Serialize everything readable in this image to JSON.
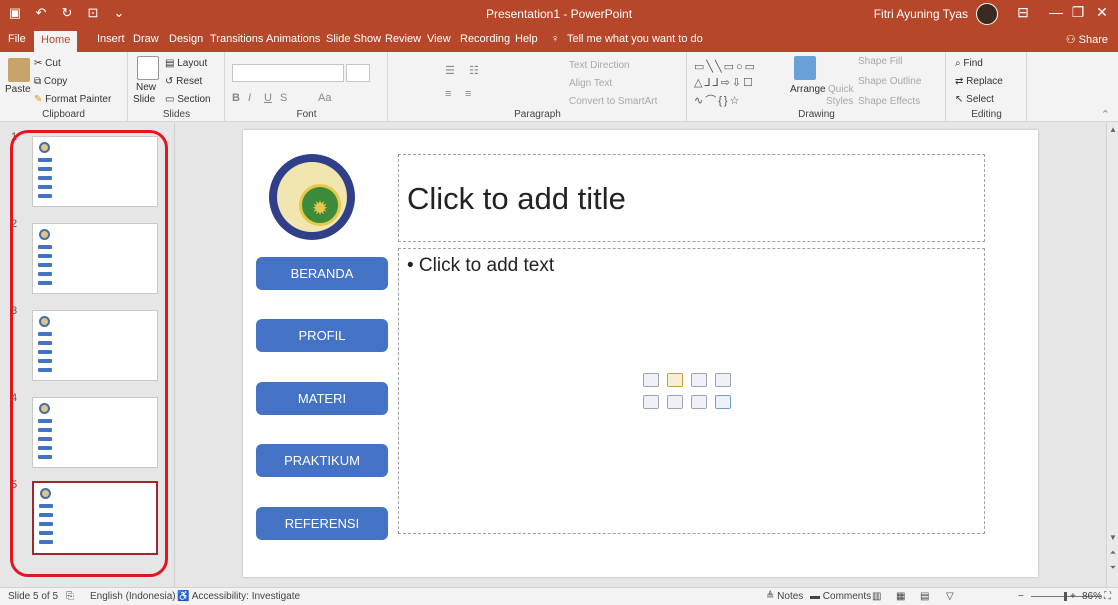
{
  "titlebar": {
    "document_title": "Presentation1 - PowerPoint",
    "user_name": "Fitri Ayuning Tyas",
    "save_icon": "save-icon",
    "undo_icon": "undo-icon",
    "redo_icon": "redo-icon",
    "start_icon": "present-from-start-icon",
    "customize_icon": "customize-quick-access-icon"
  },
  "tabs": [
    {
      "label": "File"
    },
    {
      "label": "Home"
    },
    {
      "label": "Insert"
    },
    {
      "label": "Draw"
    },
    {
      "label": "Design"
    },
    {
      "label": "Transitions"
    },
    {
      "label": "Animations"
    },
    {
      "label": "Slide Show"
    },
    {
      "label": "Review"
    },
    {
      "label": "View"
    },
    {
      "label": "Recording"
    },
    {
      "label": "Help"
    }
  ],
  "tell_me": "Tell me what you want to do",
  "share_label": "Share",
  "ribbon": {
    "clipboard": {
      "paste": "Paste",
      "cut": "Cut",
      "copy": "Copy",
      "format_painter": "Format Painter",
      "group": "Clipboard"
    },
    "slides": {
      "new_slide_line1": "New",
      "new_slide_line2": "Slide",
      "layout": "Layout",
      "reset": "Reset",
      "section": "Section",
      "group": "Slides"
    },
    "font": {
      "group": "Font",
      "bold": "B",
      "italic": "I",
      "underline": "U",
      "strike": "S",
      "grow": "A",
      "shrink": "A",
      "case": "Aa"
    },
    "paragraph": {
      "group": "Paragraph",
      "text_direction": "Text Direction",
      "align_text": "Align Text",
      "smartart": "Convert to SmartArt"
    },
    "drawing": {
      "group": "Drawing",
      "arrange": "Arrange",
      "quick_styles_line1": "Quick",
      "quick_styles_line2": "Styles",
      "shape_fill": "Shape Fill",
      "shape_outline": "Shape Outline",
      "shape_effects": "Shape Effects"
    },
    "editing": {
      "group": "Editing",
      "find": "Find",
      "replace": "Replace",
      "select": "Select"
    }
  },
  "thumbnails": [
    {
      "number": "1",
      "selected": false
    },
    {
      "number": "2",
      "selected": false
    },
    {
      "number": "3",
      "selected": false
    },
    {
      "number": "4",
      "selected": false
    },
    {
      "number": "5",
      "selected": true
    }
  ],
  "slide": {
    "title_placeholder": "Click to add title",
    "body_placeholder": "• Click to add text",
    "nav_buttons": [
      "BERANDA",
      "PROFIL",
      "MATERI",
      "PRAKTIKUM",
      "REFERENSI"
    ],
    "logo_icon": "university-logo"
  },
  "statusbar": {
    "slide_info": "Slide 5 of 5",
    "language": "English (Indonesia)",
    "accessibility": "Accessibility: Investigate",
    "notes": "Notes",
    "comments": "Comments",
    "zoom": "86%"
  },
  "colors": {
    "ribbon_accent": "#b7472a",
    "nav_button": "#4472c4",
    "annotation": "#e5151d"
  }
}
